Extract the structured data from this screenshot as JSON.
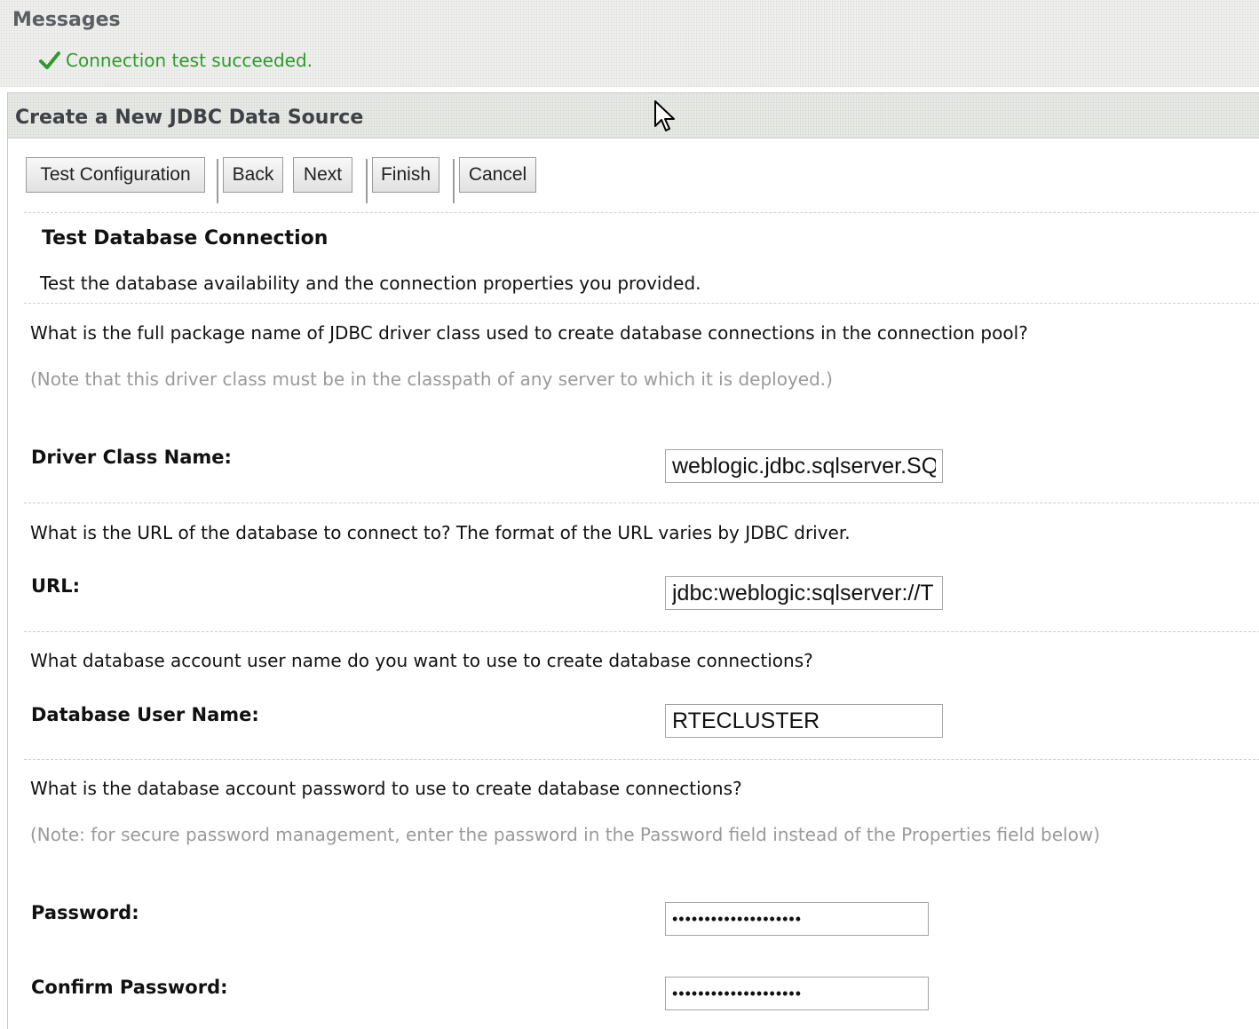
{
  "messages": {
    "title": "Messages",
    "success_text": "Connection test succeeded.",
    "success_color": "#2e9a2e",
    "icon": "check-icon"
  },
  "panel": {
    "title": "Create a New JDBC Data Source"
  },
  "toolbar": {
    "test_configuration_label": "Test Configuration",
    "back_label": "Back",
    "next_label": "Next",
    "finish_label": "Finish",
    "cancel_label": "Cancel"
  },
  "section": {
    "heading": "Test Database Connection",
    "description": "Test the database availability and the connection properties you provided."
  },
  "driver": {
    "question": "What is the full package name of JDBC driver class used to create database connections in the connection pool?",
    "note": "(Note that this driver class must be in the classpath of any server to which it is deployed.)",
    "label": "Driver Class Name:",
    "value": "weblogic.jdbc.sqlserver.SQLServerDriver"
  },
  "url": {
    "question": "What is the URL of the database to connect to? The format of the URL varies by JDBC driver.",
    "label": "URL:",
    "value": "jdbc:weblogic:sqlserver://T"
  },
  "user": {
    "question": "What database account user name do you want to use to create database connections?",
    "label": "Database User Name:",
    "value": "RTECLUSTER"
  },
  "password": {
    "question": "What is the database account password to use to create database connections?",
    "note": "(Note: for secure password management, enter the password in the Password field instead of the Properties field below)",
    "label": "Password:",
    "value": "••••••••••••••••••••",
    "confirm_label": "Confirm Password:",
    "confirm_value": "••••••••••••••••••••"
  }
}
